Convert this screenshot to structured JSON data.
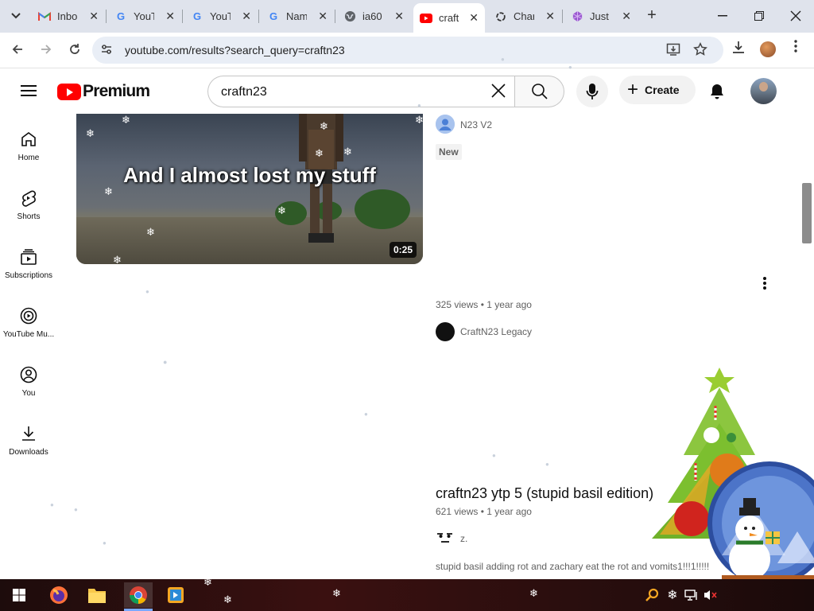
{
  "browser": {
    "tabs": [
      {
        "title": "Inbo",
        "icon": "gmail-icon",
        "active": false
      },
      {
        "title": "YouT",
        "icon": "google-icon",
        "active": false
      },
      {
        "title": "YouT",
        "icon": "google-icon",
        "active": false
      },
      {
        "title": "Nam",
        "icon": "google-icon",
        "active": false
      },
      {
        "title": "ia60",
        "icon": "globe-icon",
        "active": false
      },
      {
        "title": "craft",
        "icon": "youtube-icon",
        "active": true
      },
      {
        "title": "Char",
        "icon": "chatgpt-icon",
        "active": false
      },
      {
        "title": "Just",
        "icon": "gem-icon",
        "active": false
      }
    ],
    "url": "youtube.com/results?search_query=craftn23"
  },
  "youtube": {
    "logo_text": "Premium",
    "search_value": "craftn23",
    "create_label": "Create",
    "sidebar": [
      {
        "label": "Home",
        "icon": "home-icon"
      },
      {
        "label": "Shorts",
        "icon": "shorts-icon"
      },
      {
        "label": "Subscriptions",
        "icon": "subscriptions-icon"
      },
      {
        "label": "YouTube Mu...",
        "icon": "youtube-music-icon"
      },
      {
        "label": "You",
        "icon": "you-icon"
      },
      {
        "label": "Downloads",
        "icon": "download-icon"
      }
    ]
  },
  "results": {
    "first": {
      "thumbnail_caption": "And I almost lost my stuff",
      "duration": "0:25",
      "channel": "N23 V2",
      "badge": "New"
    },
    "second": {
      "meta": "325 views • 1 year ago",
      "channel": "CraftN23 Legacy"
    },
    "third": {
      "title": "craftn23 ytp 5 (stupid basil edition)",
      "meta": "621 views • 1 year ago",
      "channel": "z.",
      "description": "stupid basil adding rot and zachary eat the rot and vomits1!!!1!!!!!"
    }
  },
  "colors": {
    "youtube_red": "#ff0000",
    "tab_strip": "#dfe3ec",
    "omnibox": "#e9eef6"
  }
}
